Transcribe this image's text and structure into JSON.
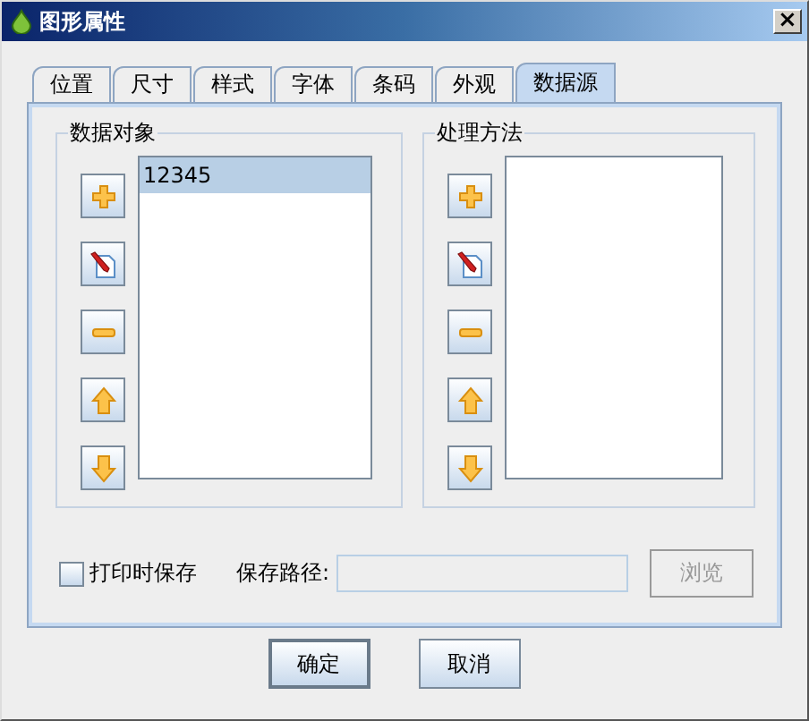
{
  "window": {
    "title": "图形属性",
    "close": "×"
  },
  "tabs": [
    {
      "label": "位置",
      "selected": false
    },
    {
      "label": "尺寸",
      "selected": false
    },
    {
      "label": "样式",
      "selected": false
    },
    {
      "label": "字体",
      "selected": false
    },
    {
      "label": "条码",
      "selected": false
    },
    {
      "label": "外观",
      "selected": false
    },
    {
      "label": "数据源",
      "selected": true
    }
  ],
  "groups": [
    {
      "label": "数据对象",
      "tools": [
        {
          "kind": "add"
        },
        {
          "kind": "edit"
        },
        {
          "kind": "remove"
        },
        {
          "kind": "up"
        },
        {
          "kind": "down"
        }
      ],
      "items": [
        {
          "label": "12345",
          "selected": true
        }
      ]
    },
    {
      "label": "处理方法",
      "tools": [
        {
          "kind": "add"
        },
        {
          "kind": "edit"
        },
        {
          "kind": "remove"
        },
        {
          "kind": "up"
        },
        {
          "kind": "down"
        }
      ]
    }
  ],
  "save_on_print": {
    "label": "打印时保存",
    "checked": false
  },
  "save_path": {
    "label": "保存路径:",
    "disabled": true
  },
  "browse_button": {
    "label": "浏览",
    "disabled": true
  },
  "buttons": [
    {
      "label": "确定",
      "default": true
    },
    {
      "label": "取消",
      "default": false
    }
  ]
}
